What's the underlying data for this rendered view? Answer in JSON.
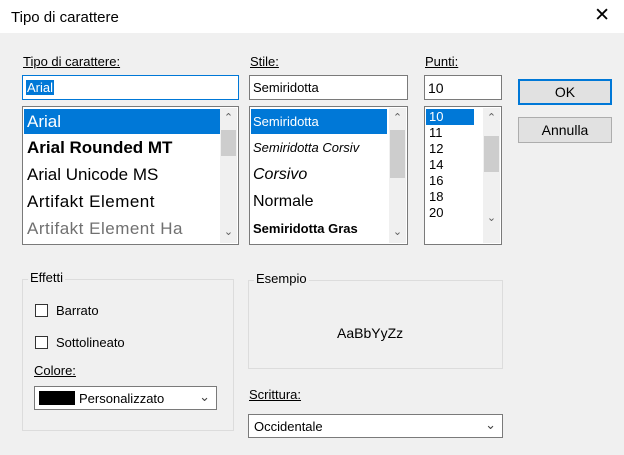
{
  "window": {
    "title": "Tipo di carattere",
    "close_glyph": "✕"
  },
  "font": {
    "label": "Tipo di carattere:",
    "value": "Arial",
    "items": [
      "Arial",
      "Arial Rounded MT",
      "Arial Unicode MS",
      "Artifakt Element",
      "Artifakt Element Ha"
    ],
    "selected": "Arial"
  },
  "style": {
    "label": "Stile:",
    "value": "Semiridotta",
    "items": [
      "Semiridotta",
      "Semiridotta Corsiv",
      "Corsivo",
      "Normale",
      "Semiridotta Gras"
    ],
    "selected": "Semiridotta"
  },
  "size": {
    "label": "Punti:",
    "value": "10",
    "items": [
      "10",
      "11",
      "12",
      "14",
      "16",
      "18",
      "20"
    ],
    "selected": "10"
  },
  "buttons": {
    "ok": "OK",
    "cancel": "Annulla"
  },
  "effects": {
    "label": "Effetti",
    "strikeout": "Barrato",
    "underline": "Sottolineato",
    "color_label": "Colore:",
    "color_value": "Personalizzato",
    "color_swatch": "#000000"
  },
  "sample": {
    "label": "Esempio",
    "text": "AaBbYyZz"
  },
  "script": {
    "label": "Scrittura:",
    "value": "Occidentale"
  },
  "colors": {
    "accent": "#0078d7",
    "background": "#f0f0f0"
  }
}
